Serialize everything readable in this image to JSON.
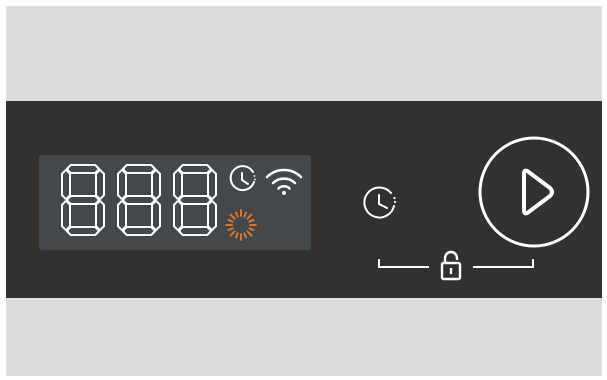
{
  "colors": {
    "frame": "#dcdcde",
    "panel": "#323130",
    "display_bg": "#45484a",
    "segment_on": "#ffffff",
    "accent_orange": "#f07a2a"
  },
  "display": {
    "digits": [
      "8",
      "8",
      "8"
    ],
    "icons": [
      "timer-icon",
      "wifi-icon",
      "sparkle-icon"
    ]
  },
  "controls": {
    "timer_button_icon": "timer-icon",
    "start_button_icon": "play-icon",
    "child_lock_icon": "unlocked-padlock-icon"
  }
}
